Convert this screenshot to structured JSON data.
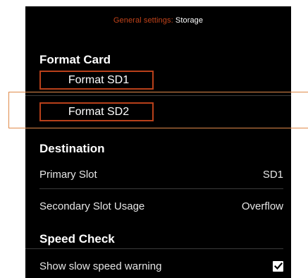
{
  "header": {
    "section": "General settings:",
    "page": "Storage"
  },
  "format_card": {
    "title": "Format Card",
    "buttons": [
      {
        "label": "Format SD1",
        "focused": false
      },
      {
        "label": "Format SD2",
        "focused": true
      }
    ]
  },
  "destination": {
    "title": "Destination",
    "rows": [
      {
        "label": "Primary Slot",
        "value": "SD1"
      },
      {
        "label": "Secondary Slot Usage",
        "value": "Overflow"
      }
    ]
  },
  "speed_check": {
    "title": "Speed Check",
    "rows": [
      {
        "label": "Show slow speed warning",
        "checked": true
      }
    ]
  },
  "colors": {
    "background": "#000000",
    "accent": "#b8401a",
    "focus_outline": "#e08a4a",
    "text": "#ffffff"
  },
  "icons": {
    "checkbox": "checkmark-icon"
  }
}
